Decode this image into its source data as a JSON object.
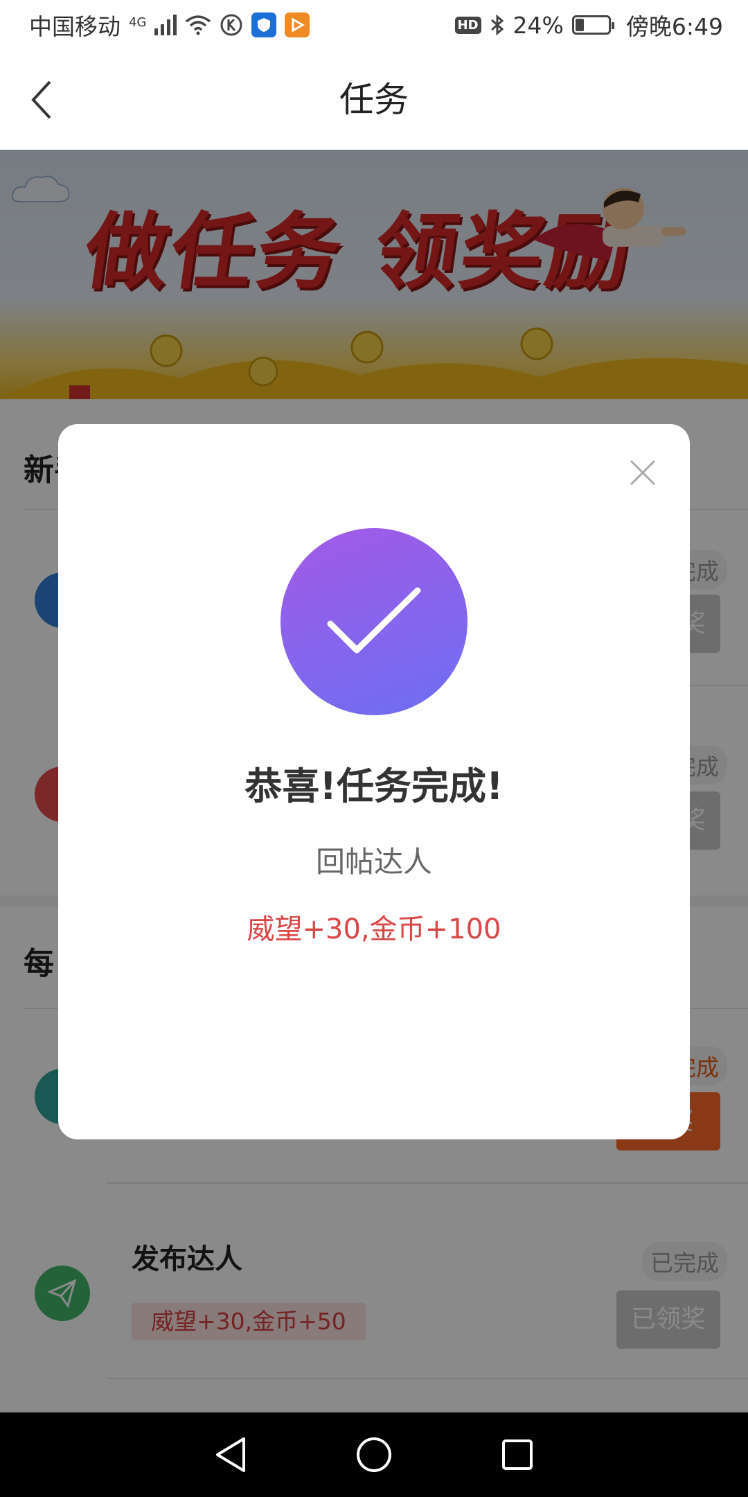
{
  "status_bar": {
    "carrier": "中国移动",
    "network": "4G",
    "battery_percent": "24%",
    "battery_level": 0.24,
    "time": "傍晚6:49",
    "hd_badge": "HD"
  },
  "nav": {
    "title": "任务",
    "back_icon": "chevron-left-icon"
  },
  "banner": {
    "text": "做任务 领奖励"
  },
  "sections": {
    "newbie_title": "新手任务",
    "daily_title": "每日任务"
  },
  "tasks": [
    {
      "name": "",
      "reward": "",
      "status": "已完成",
      "button": "已领奖"
    },
    {
      "name": "",
      "reward": "",
      "status": "已完成",
      "button": "已领奖"
    },
    {
      "name": "",
      "reward": "",
      "status": "已完成",
      "button": "领奖"
    },
    {
      "name": "发布达人",
      "reward": "威望+30,金币+50",
      "status": "已完成",
      "button": "已领奖"
    }
  ],
  "dialog": {
    "title": "恭喜!任务完成!",
    "task_name": "回帖达人",
    "reward": "威望+30,金币+100",
    "accent_color": "#8a63ec",
    "reward_color": "#d94646"
  },
  "colors": {
    "primary_orange": "#ff6a2c",
    "reward_red": "#d94040"
  }
}
